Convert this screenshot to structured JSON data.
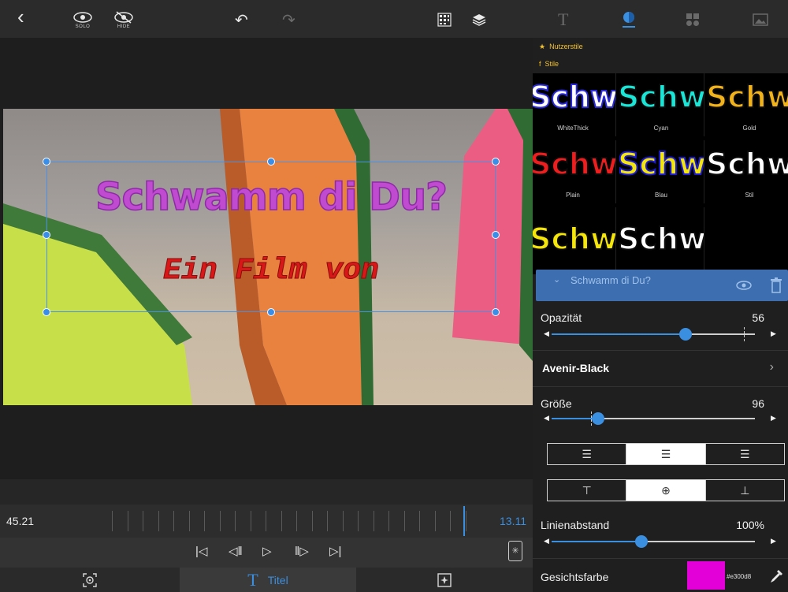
{
  "toolbar": {
    "back": "‹",
    "solo_label": "SOLO",
    "hide_label": "HIDE",
    "undo": "↶",
    "redo": "↷",
    "tab_text": "T"
  },
  "preview": {
    "title": "Schwamm di Du?",
    "subtitle": "Ein Film von",
    "title_color": "#c04ad0",
    "subtitle_color": "#d81818"
  },
  "timeline": {
    "start_time": "45.21",
    "end_time": "13.11"
  },
  "transport": {
    "start": "⏮",
    "prev_frame": "◁",
    "play": "▷",
    "next_frame": "▷",
    "end": "⏭"
  },
  "bottom_tabs": {
    "titel_label": "Titel",
    "titel_icon": "T"
  },
  "styles": {
    "user_styles_label": "Nutzerstile",
    "styles_label": "Stile",
    "sample_text": "Schw",
    "items": [
      {
        "name": "WhiteThick",
        "color": "#ffffff",
        "stroke": "#2a2ad8"
      },
      {
        "name": "Cyan",
        "color": "#19e6d6",
        "stroke": "#0a0a0a"
      },
      {
        "name": "Gold",
        "color": "#f2b21a",
        "stroke": "#0a0a0a"
      },
      {
        "name": "Plain",
        "color": "#ef1e1e",
        "stroke": "#0a0a0a"
      },
      {
        "name": "Blau",
        "color": "#f5e60a",
        "stroke": "#1a1ad8"
      },
      {
        "name": "Stil",
        "color": "#ffffff",
        "stroke": "#0a0a0a"
      },
      {
        "name": "",
        "color": "#f5e60a",
        "stroke": "#0a0a0a"
      },
      {
        "name": "",
        "color": "#ffffff",
        "stroke": "#0a0a0a"
      }
    ]
  },
  "layer": {
    "name": "Schwamm di Du?",
    "chevron": "⌄"
  },
  "properties": {
    "opacity_label": "Opazität",
    "opacity_value": "56",
    "opacity_fraction": 0.66,
    "font_name": "Avenir-Black",
    "size_label": "Größe",
    "size_value": "96",
    "size_fraction": 0.23,
    "line_spacing_label": "Linienabstand",
    "line_spacing_value": "100%",
    "line_spacing_fraction": 0.44,
    "face_color_label": "Gesichtsfarbe",
    "face_color": "#e300d8",
    "face_color_hex": "#e300d8"
  }
}
